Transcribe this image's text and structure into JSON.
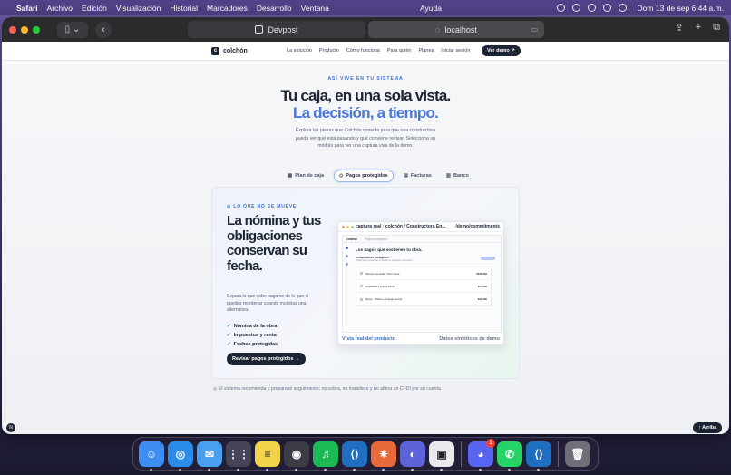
{
  "menubar": {
    "app": "Safari",
    "menus": [
      "Archivo",
      "Edición",
      "Visualización",
      "Historial",
      "Marcadores",
      "Desarrollo",
      "Ventana"
    ],
    "help": "Ayuda",
    "clock": "Dom 13 de sep  6:44 a.m."
  },
  "browser": {
    "tab_title": "Devpost",
    "address": "localhost"
  },
  "site": {
    "logo": "colchón",
    "nav": [
      "La solución",
      "Producto",
      "Cómo funciona",
      "Para quién",
      "Planes",
      "Iniciar sesión"
    ],
    "nav_cta": "Ver demo ↗"
  },
  "hero": {
    "eyebrow": "ASÍ VIVE EN TU SISTEMA",
    "title_line1": "Tu caja, en una sola vista.",
    "title_line2": "La decisión, a tiempo.",
    "lede": "Explora las piezas que Colchón conecta para que una constructora pueda ver qué está pasando y qué conviene revisar. Selecciona un módulo para ver una captura viva de la demo."
  },
  "tabs": [
    {
      "icon": "▦",
      "label": "Plan de caja"
    },
    {
      "icon": "◇",
      "label": "Pagos protegidos"
    },
    {
      "icon": "▤",
      "label": "Facturas"
    },
    {
      "icon": "▥",
      "label": "Banco"
    }
  ],
  "card": {
    "tag": "◎ LO QUE NO SE MUEVE",
    "title": "La nómina y tus obligaciones conservan su fecha.",
    "description": "Separa lo que debe pagarse de lo que sí puedes reordenar cuando modelas una alternativa.",
    "checks": [
      "Nómina de la obra",
      "Impuestos y renta",
      "Fechas protegidas"
    ],
    "cta": "Revisar pagos protegidos →"
  },
  "preview": {
    "window_title": "captura real · colchón / Constructora En...",
    "path": "/demo/commitments",
    "app_brand": "colchón",
    "app_crumb": "Pagos protegidos",
    "heading": "Los pagos que sostienen tu obra.",
    "section": "Compromisos protegidos",
    "section_sub": "Pagos que conservan su fecha en cualquier escenario.",
    "rows": [
      {
        "name": "Nómina semanal · Torre Norte",
        "amount": "$186,000"
      },
      {
        "name": "Impuestos y cuotas IMSS",
        "amount": "$74,500"
      },
      {
        "name": "Renta · Oficina y bodega central",
        "amount": "$42,000"
      }
    ],
    "footer_left": "Vista real del producto",
    "footer_right": "Datos sintéticos de demo"
  },
  "disclaimer": "◎ El sistema recomienda y prepara el seguimiento; no cobra, no transfiere y no altera un CFDI por su cuenta.",
  "fab_left": "N",
  "fab_right": "↑ Arriba",
  "dock": {
    "apps": [
      {
        "name": "finder",
        "color": "#3d8ef0",
        "glyph": "☺"
      },
      {
        "name": "safari",
        "color": "#2a8be8",
        "glyph": "◎"
      },
      {
        "name": "mail",
        "color": "#4aa0f0",
        "glyph": "✉"
      },
      {
        "name": "launchpad",
        "color": "#444456",
        "glyph": "⋮⋮"
      },
      {
        "name": "notes",
        "color": "#f3d34a",
        "glyph": "≡"
      },
      {
        "name": "chrome-like",
        "color": "#3c3c44",
        "glyph": "◉"
      },
      {
        "name": "spotify",
        "color": "#1db954",
        "glyph": "♫"
      },
      {
        "name": "vscode",
        "color": "#1f6fc0",
        "glyph": "⟨⟩"
      },
      {
        "name": "spark",
        "color": "#e86a3a",
        "glyph": "✷"
      },
      {
        "name": "proton",
        "color": "#5d63d8",
        "glyph": "◐"
      },
      {
        "name": "screen",
        "color": "#e9e9ee",
        "glyph": "▣"
      },
      {
        "name": "discord",
        "color": "#5865f2",
        "glyph": "◕",
        "badge": "1"
      },
      {
        "name": "whatsapp",
        "color": "#25d366",
        "glyph": "✆"
      },
      {
        "name": "vscode-2",
        "color": "#1f6fc0",
        "glyph": "⟨⟩"
      },
      {
        "name": "trash",
        "color": "#6f6f78",
        "glyph": "🗑"
      }
    ]
  }
}
